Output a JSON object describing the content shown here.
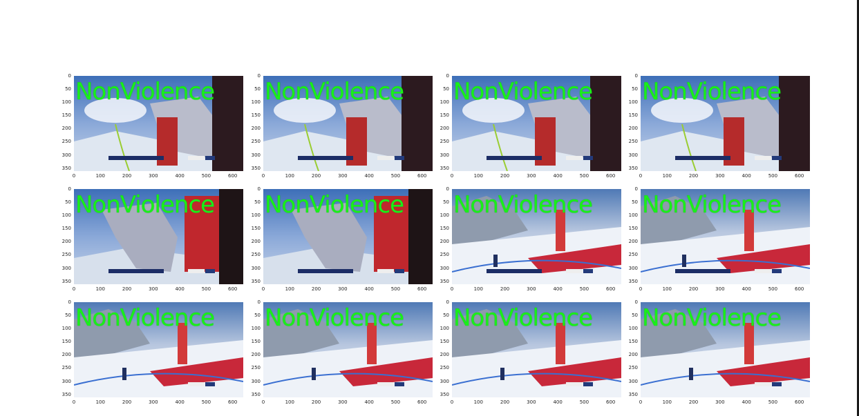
{
  "grid": {
    "rows": 3,
    "cols": 4,
    "label_text": "NonViolence",
    "label_color": "#19f019",
    "y_ticks": [
      "0",
      "50",
      "100",
      "150",
      "200",
      "250",
      "300",
      "350"
    ],
    "x_ticks": [
      "0",
      "100",
      "200",
      "300",
      "400",
      "500",
      "600"
    ]
  },
  "frames": [
    {
      "scene": "closeup-skier",
      "label": "NonViolence"
    },
    {
      "scene": "closeup-skier",
      "label": "NonViolence"
    },
    {
      "scene": "closeup-skier",
      "label": "NonViolence"
    },
    {
      "scene": "closeup-skier",
      "label": "NonViolence"
    },
    {
      "scene": "closeup-start",
      "label": "NonViolence"
    },
    {
      "scene": "closeup-start",
      "label": "NonViolence"
    },
    {
      "scene": "wide-slope",
      "label": "NonViolence"
    },
    {
      "scene": "wide-slope",
      "label": "NonViolence"
    },
    {
      "scene": "wide-slope-2",
      "label": "NonViolence"
    },
    {
      "scene": "wide-slope-2",
      "label": "NonViolence"
    },
    {
      "scene": "wide-slope-2",
      "label": "NonViolence"
    },
    {
      "scene": "wide-slope-2",
      "label": "NonViolence"
    }
  ]
}
